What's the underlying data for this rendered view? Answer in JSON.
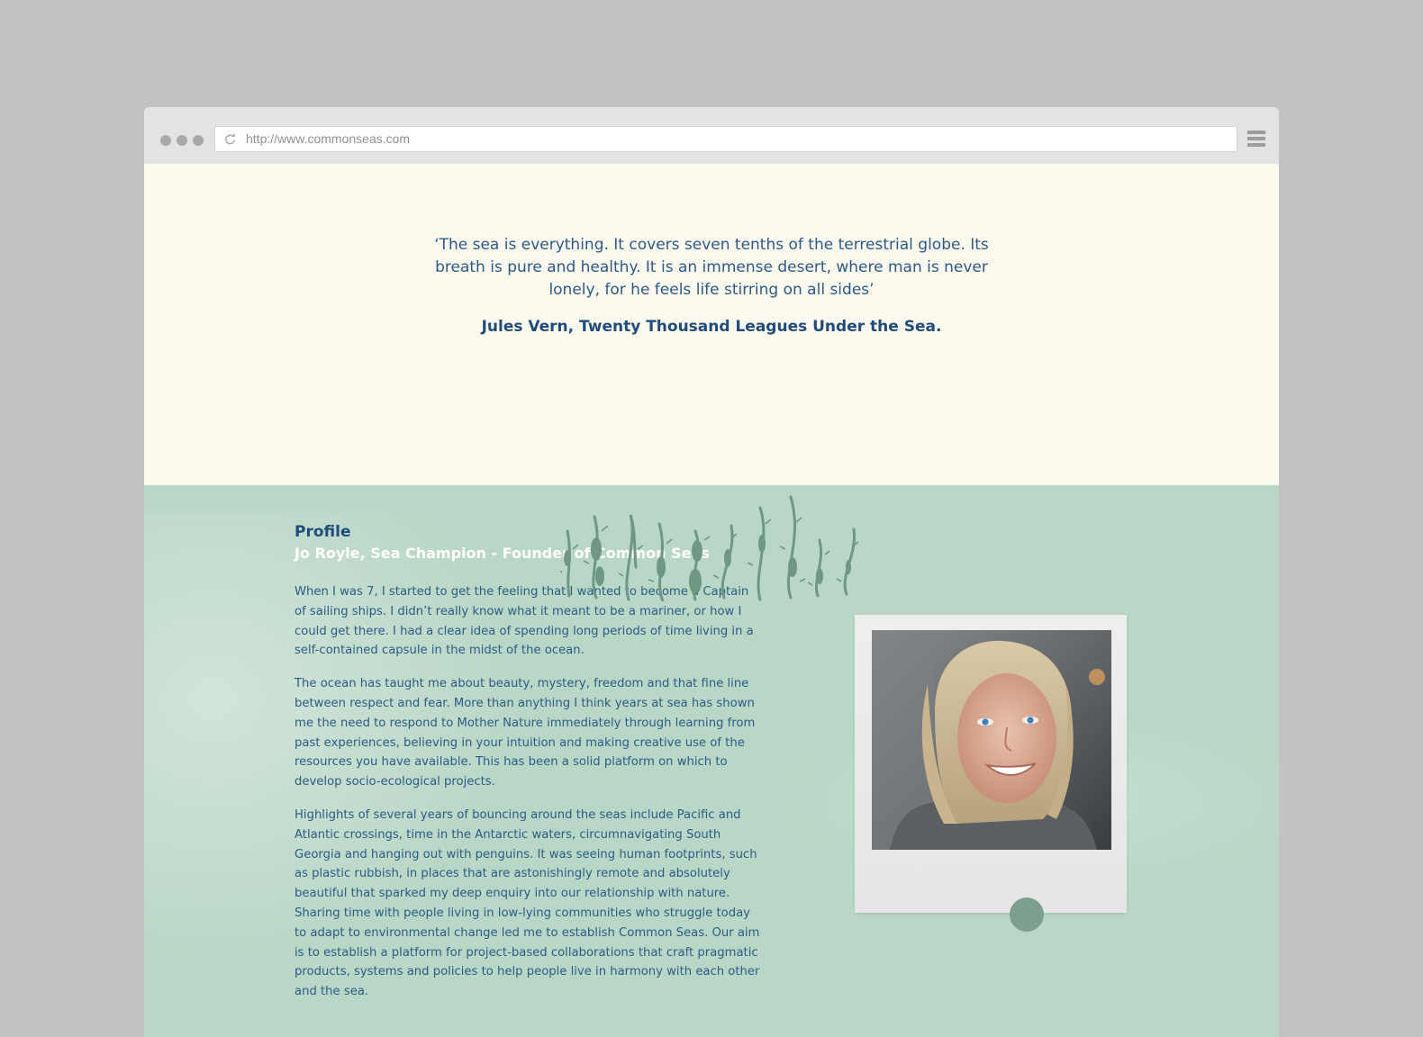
{
  "browser": {
    "url": "http://www.commonseas.com"
  },
  "icons": {
    "reload": "reload-icon",
    "menu": "hamburger-menu-icon",
    "seaweed": "seaweed-illustration"
  },
  "quote": {
    "text": "‘The sea is everything. It covers seven tenths of the terrestrial globe. Its breath is pure and healthy. It is an immense desert, where man is never lonely, for he feels life stirring on all sides’",
    "attribution": "Jules Vern, Twenty Thousand Leagues Under the Sea."
  },
  "profile": {
    "heading": "Profile",
    "subtitle": "Jo Royle, Sea Champion - Founder of Common Seas",
    "paragraphs": [
      "When I was 7, I started to get the feeling that I wanted to become a Captain of sailing ships. I didn’t really know what it meant to be a mariner, or how I could get there. I had a clear idea of spending long periods of time living in a self-contained capsule in the midst of the ocean.",
      "The ocean has taught me about beauty, mystery, freedom and that fine line between respect and fear. More than anything I think years at sea has shown me the need to respond to Mother Nature immediately through learning from past experiences, believing in your intuition and making creative use of the resources you have available.  This has been a solid platform on which to develop socio-ecological projects.",
      "Highlights of several years of bouncing around the seas include Pacific and Atlantic crossings, time in the Antarctic waters, circumnavigating South Georgia and hanging out with penguins. It was seeing human footprints, such as plastic rubbish, in places that are astonishingly remote and absolutely beautiful that sparked my deep enquiry into our relationship with nature. Sharing time with people living in low-lying communities who struggle today to adapt to environmental change led me to establish Common Seas. Our aim is to establish a platform for project-based collaborations that craft pragmatic products, systems and policies to help people live in harmony with each other and the sea."
    ]
  },
  "colors": {
    "page_background": "#c3c2c3",
    "cream": "#fcf9ee",
    "sea_green": "#b9d7c6",
    "navy_text": "#1f4c7c",
    "seaweed": "#6f9784"
  }
}
